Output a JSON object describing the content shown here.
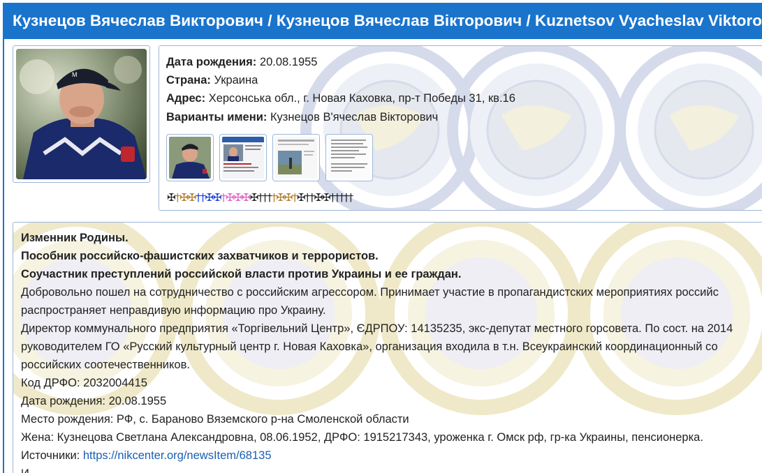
{
  "header": {
    "title": "Кузнецов Вячеслав Викторович / Кузнецов Вячеслав Вікторович / Kuznetsov Vyacheslav Viktorovich"
  },
  "colors": {
    "header_bg": "#1a74cc",
    "border": "#9db7d8",
    "link": "#1a5fb4",
    "watermark": "#c5cbe0"
  },
  "info": {
    "birth_label": "Дата рождения:",
    "birth_value": "20.08.1955",
    "country_label": "Страна:",
    "country_value": "Украина",
    "address_label": "Адрес:",
    "address_value": "Херсонська обл., г. Новая Каховка, пр-т Победы 31, кв.16",
    "variants_label": "Варианты имени:",
    "variants_value": "Кузнецов В'ячеслав Вікторович"
  },
  "thumbnails": [
    {
      "icon": "person-photo-thumbnail"
    },
    {
      "icon": "news-screenshot-thumbnail"
    },
    {
      "icon": "document-screenshot-thumbnail"
    },
    {
      "icon": "text-document-thumbnail"
    }
  ],
  "crosses": [
    {
      "ch": "✠",
      "color": "#222222"
    },
    {
      "ch": "†",
      "color": "#b07d2a"
    },
    {
      "ch": "✠",
      "color": "#b07d2a"
    },
    {
      "ch": "✠",
      "color": "#b07d2a"
    },
    {
      "ch": "†",
      "color": "#1e3fd8"
    },
    {
      "ch": "†",
      "color": "#1e3fd8"
    },
    {
      "ch": "✠",
      "color": "#1e3fd8"
    },
    {
      "ch": "✠",
      "color": "#1e3fd8"
    },
    {
      "ch": "†",
      "color": "#e060c8"
    },
    {
      "ch": "✠",
      "color": "#e060c8"
    },
    {
      "ch": "✠",
      "color": "#e060c8"
    },
    {
      "ch": "✠",
      "color": "#e060c8"
    },
    {
      "ch": "✠",
      "color": "#222222"
    },
    {
      "ch": "†",
      "color": "#222222"
    },
    {
      "ch": "†",
      "color": "#222222"
    },
    {
      "ch": "†",
      "color": "#222222"
    },
    {
      "ch": "†",
      "color": "#b07d2a"
    },
    {
      "ch": "✠",
      "color": "#b07d2a"
    },
    {
      "ch": "✠",
      "color": "#b07d2a"
    },
    {
      "ch": "†",
      "color": "#b07d2a"
    },
    {
      "ch": "✠",
      "color": "#222222"
    },
    {
      "ch": "†",
      "color": "#222222"
    },
    {
      "ch": "†",
      "color": "#222222"
    },
    {
      "ch": "✠",
      "color": "#222222"
    },
    {
      "ch": "✠",
      "color": "#222222"
    },
    {
      "ch": "†",
      "color": "#222222"
    },
    {
      "ch": "†",
      "color": "#222222"
    },
    {
      "ch": "†",
      "color": "#222222"
    },
    {
      "ch": "†",
      "color": "#222222"
    },
    {
      "ch": "†",
      "color": "#222222"
    }
  ],
  "description": {
    "line1": "Изменник Родины.",
    "line2": "Пособник российско-фашистских захватчиков и террористов.",
    "line3": "Соучастник преступлений российской власти против Украины и ее граждан.",
    "line4": "Добровольно пошел на сотрудничество с российским агрессором. Принимает участие  в пропагандистских мероприятиях российс",
    "line5": "распространяет неправдивую информацию про Украину.",
    "line6": "Директор коммунального предприятия «Торгівельний Центр», ЄДРПОУ: 14135235, экс-депутат местного горсовета. По сост. на 2014",
    "line7": "руководителем ГО  «Русский культурный центр г. Новая Каховка», организация входила в т.н. Всеукраинский координационный со",
    "line8": "российских соотечественников.",
    "line9": "Код ДРФО: 2032004415",
    "line10": "Дата рождения: 20.08.1955",
    "line11": "Место рождения: РФ, с. Бараново Вяземского р-на Смоленской области",
    "line12": "Жена: Кузнецова Светлана Александровна, 08.06.1952, ДРФО: 1915217343, уроженка г. Омск рф, гр-ка Украины, пенсионерка.",
    "sources_label": "Источники:",
    "sources_link": "https://nikcenter.org/newsItem/68135",
    "line14": "И"
  }
}
